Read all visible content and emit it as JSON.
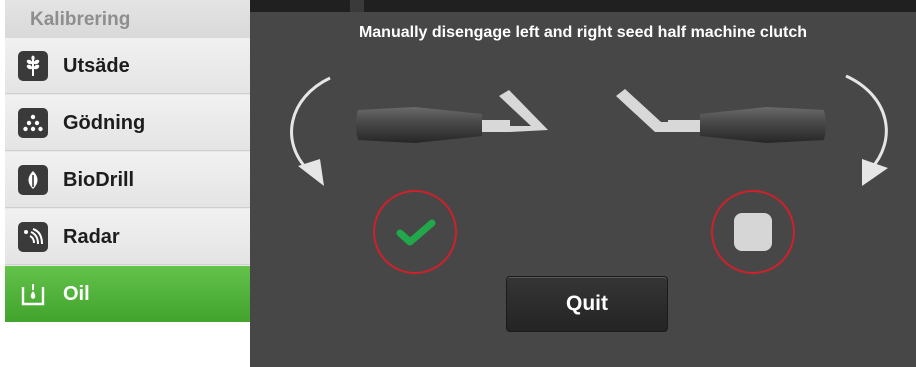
{
  "sidebar": {
    "header": "Kalibrering",
    "items": [
      {
        "label": "Utsäde",
        "icon": "seed-icon",
        "active": false
      },
      {
        "label": "Gödning",
        "icon": "fertilizer-icon",
        "active": false
      },
      {
        "label": "BioDrill",
        "icon": "biodrill-icon",
        "active": false
      },
      {
        "label": "Radar",
        "icon": "radar-icon",
        "active": false
      },
      {
        "label": "Oil",
        "icon": "oil-icon",
        "active": true
      }
    ]
  },
  "dialog": {
    "title": "Manually disengage left and right seed half machine clutch",
    "left_status": "check-icon",
    "right_status": "stop-icon",
    "quit_label": "Quit"
  },
  "colors": {
    "active_green": "#4caf35",
    "dialog_bg": "#474747",
    "ring_red": "#d0202a",
    "check_green": "#22a84a"
  }
}
